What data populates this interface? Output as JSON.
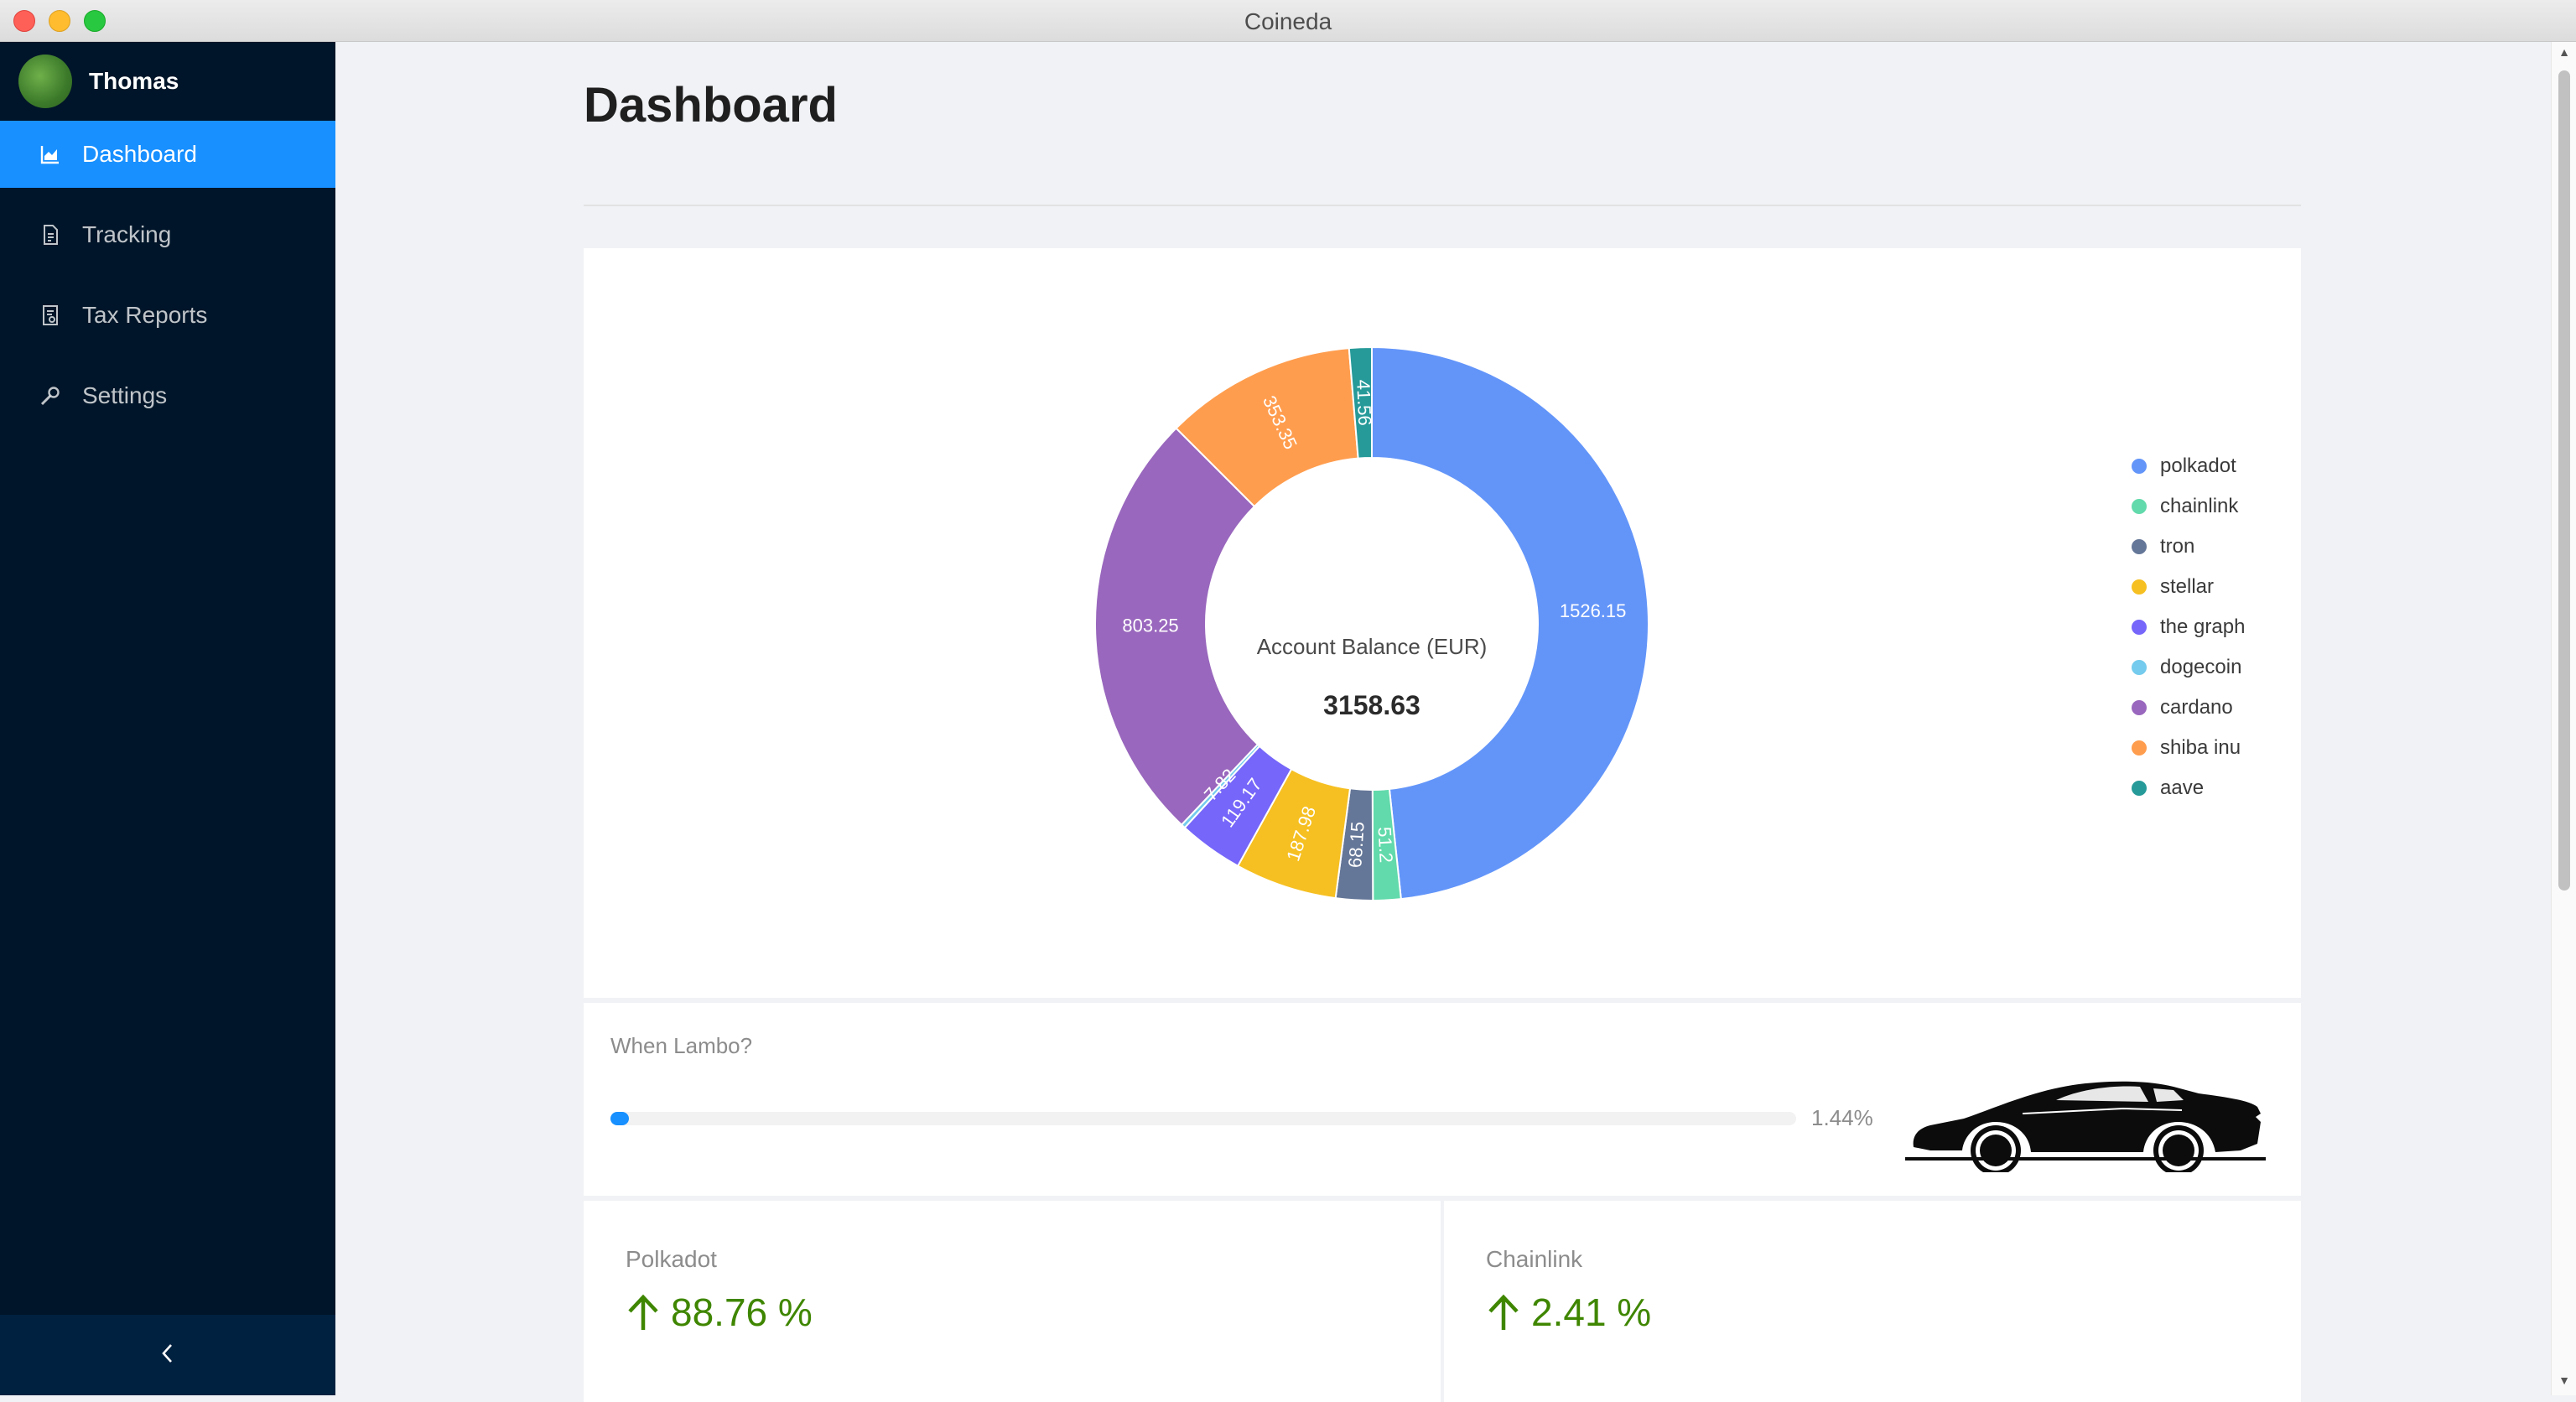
{
  "window": {
    "title": "Coineda"
  },
  "user": {
    "name": "Thomas"
  },
  "sidebar": {
    "items": [
      {
        "label": "Dashboard",
        "icon": "area-chart-icon",
        "active": true
      },
      {
        "label": "Tracking",
        "icon": "file-icon",
        "active": false
      },
      {
        "label": "Tax Reports",
        "icon": "audit-icon",
        "active": false
      },
      {
        "label": "Settings",
        "icon": "tool-icon",
        "active": false
      }
    ],
    "collapse_icon": "chevron-left-icon"
  },
  "page": {
    "title": "Dashboard"
  },
  "chart_data": {
    "type": "pie",
    "center_label": "Account Balance (EUR)",
    "center_value": "3158.63",
    "legend_position": "right",
    "slices": [
      {
        "name": "polkadot",
        "value": 1526.15,
        "label": "1526.15",
        "color": "#6395f9"
      },
      {
        "name": "chainlink",
        "value": 51.2,
        "label": "51.2",
        "color": "#62daab"
      },
      {
        "name": "tron",
        "value": 68.15,
        "label": "68.15",
        "color": "#657798"
      },
      {
        "name": "stellar",
        "value": 187.98,
        "label": "187.98",
        "color": "#f6c022"
      },
      {
        "name": "the graph",
        "value": 119.17,
        "label": "119.17",
        "color": "#7666f9"
      },
      {
        "name": "dogecoin",
        "value": 7.82,
        "label": "7.82",
        "color": "#74cbed"
      },
      {
        "name": "cardano",
        "value": 803.25,
        "label": "803.25",
        "color": "#9967bd"
      },
      {
        "name": "shiba inu",
        "value": 353.35,
        "label": "353.35",
        "color": "#ff9d4e"
      },
      {
        "name": "aave",
        "value": 41.56,
        "label": "41.56",
        "color": "#269a99"
      }
    ]
  },
  "lambo": {
    "label": "When Lambo?",
    "progress_percent": 1.44,
    "progress_text": "1.44%"
  },
  "stats": [
    {
      "label": "Polkadot",
      "value": "88.76 %",
      "direction": "up",
      "color": "#3f8600"
    },
    {
      "label": "Chainlink",
      "value": "2.41 %",
      "direction": "up",
      "color": "#3f8600"
    }
  ]
}
